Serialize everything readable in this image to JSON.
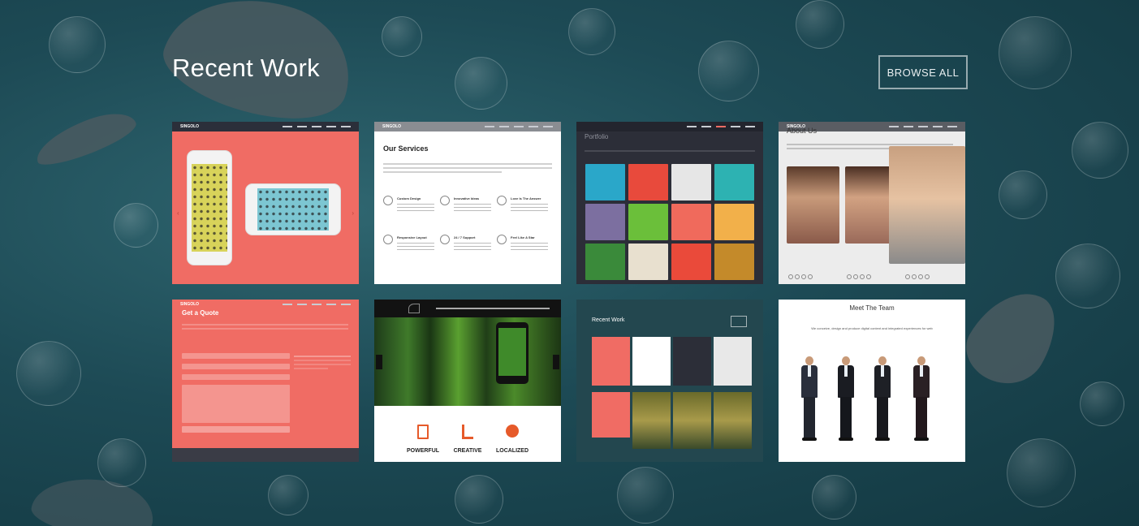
{
  "section": {
    "title": "Recent Work",
    "browse_label": "BROWSE ALL"
  },
  "thumbnails": [
    {
      "name": "singolo-home",
      "logo": "SINGOLO"
    },
    {
      "name": "our-services",
      "logo": "SINGOLO",
      "heading": "Our Services",
      "services": [
        "Custom Design",
        "Innovative Ideas",
        "Love Is The Answer",
        "Responsive Layout",
        "24 / 7 Support",
        "Feel Like A Star"
      ]
    },
    {
      "name": "portfolio",
      "title": "Portfolio"
    },
    {
      "name": "about-us",
      "logo": "SINGOLO",
      "title": "About Us"
    },
    {
      "name": "get-a-quote",
      "logo": "SINGOLO",
      "title": "Get a Quote"
    },
    {
      "name": "forest-phone",
      "features": [
        "POWERFUL",
        "CREATIVE",
        "LOCALIZED"
      ]
    },
    {
      "name": "recent-work",
      "title": "Recent Work"
    },
    {
      "name": "meet-the-team",
      "title": "Meet The Team",
      "subtitle": "We conceive, design and produce digital content and integrated experiences for web"
    }
  ],
  "colors": {
    "coral": "#f06c64",
    "dark_nav": "#2b2f3a",
    "ocean": "#1d4a55"
  }
}
